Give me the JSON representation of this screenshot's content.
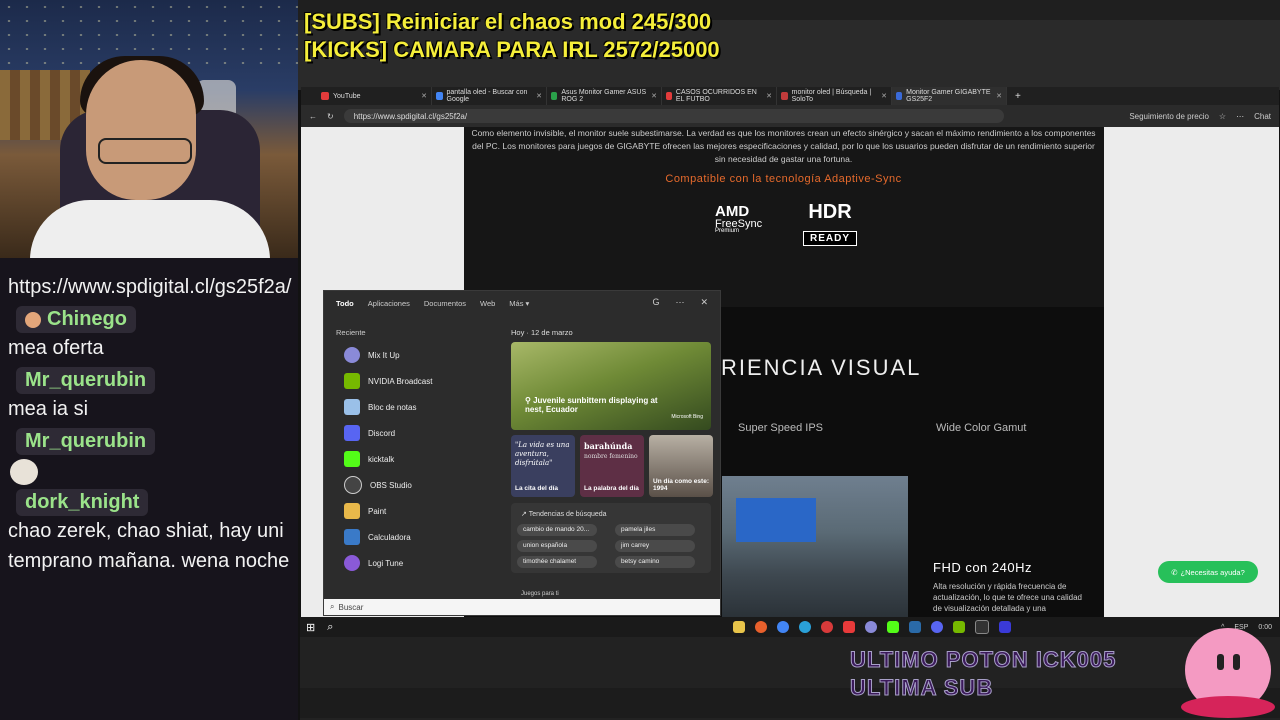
{
  "overlay": {
    "line1": "[SUBS] Reiniciar el chaos mod 245/300",
    "line2": "[KICKS] CAMARA PARA IRL 2572/25000",
    "bottom1": "ULTIMO POTON",
    "bottom2": "ULTIMA SUB",
    "bottom_tag": "ICK005"
  },
  "chat": {
    "messages": [
      {
        "text": "https://www.spdigital.cl/gs25f2a/"
      },
      {
        "name": "Chinego",
        "text": "mea oferta"
      },
      {
        "name": "Mr_querubin",
        "text": "mea ia si"
      },
      {
        "name": "Mr_querubin",
        "text": ""
      },
      {
        "name": "dork_knight",
        "text": "chao zerek, chao shiat, hay uni temprano mañana. wena noche"
      }
    ]
  },
  "browser": {
    "tabs": [
      {
        "label": "YouTube"
      },
      {
        "label": "pantalla oled - Buscar con Google"
      },
      {
        "label": "Asus Monitor Gamer ASUS ROG 2"
      },
      {
        "label": "CASOS OCURRIDOS EN EL FUTBO"
      },
      {
        "label": "monitor oled | Búsqueda | SoloTo"
      },
      {
        "label": "Monitor Gamer GIGABYTE GS25F2"
      }
    ],
    "url": "https://www.spdigital.cl/gs25f2a/",
    "price_tracking": "Seguimiento de precio",
    "chat_label": "Chat"
  },
  "page": {
    "paragraph": "Como elemento invisible, el monitor suele subestimarse. La verdad es que los monitores crean un efecto sinérgico y sacan el máximo rendimiento a los componentes del PC. Los monitores para juegos de GIGABYTE ofrecen las mejores especificaciones y calidad, por lo que los usuarios pueden disfrutar de un rendimiento superior sin necesidad de gastar una fortuna.",
    "compat": "Compatible con la tecnología Adaptive-Sync",
    "amd": "AMD",
    "freesync": "FreeSync",
    "premium": "Premium",
    "hdr": "HDR",
    "ready": "READY",
    "visual": "RIENCIA VISUAL",
    "tab1": "Super Speed IPS",
    "tab2": "Wide Color Gamut",
    "fhd_title": "FHD con 240Hz",
    "fhd_desc": "Alta resolución y rápida frecuencia de actualización, lo que te ofrece una calidad de visualización detallada y una",
    "whatsapp": "¿Necesitas ayuda?"
  },
  "start": {
    "tabs": [
      "Todo",
      "Aplicaciones",
      "Documentos",
      "Web",
      "Más ▾"
    ],
    "recent_title": "Reciente",
    "apps": [
      {
        "label": "Mix It Up",
        "color": "#8a8ad8"
      },
      {
        "label": "NVIDIA Broadcast",
        "color": "#76b900"
      },
      {
        "label": "Bloc de notas",
        "color": "#9ac0e8"
      },
      {
        "label": "Discord",
        "color": "#5865f2"
      },
      {
        "label": "kicktalk",
        "color": "#53fc18"
      },
      {
        "label": "OBS Studio",
        "color": "#444444"
      },
      {
        "label": "Paint",
        "color": "#e8b84a"
      },
      {
        "label": "Calculadora",
        "color": "#3a7ac8"
      },
      {
        "label": "Logi Tune",
        "color": "#8a5ad8"
      }
    ],
    "today": "Hoy  ·  12 de marzo",
    "featured_caption": "Juvenile sunbittern displaying at nest, Ecuador",
    "ms_bing": "Microsoft Bing",
    "card1_quote": "\"La vida es una aventura, disfrútala\"",
    "card1_label": "La cita del día",
    "card2_word": "barahúnda",
    "card2_sub": "nombre femenino",
    "card2_label": "La palabra del día",
    "card3_label": "Un día como este: 1994",
    "trends_title": "Tendencias de búsqueda",
    "trends": [
      "cambio de mando 20...",
      "pamela jiles",
      "union española",
      "jim carrey",
      "timothée chalamet",
      "betsy camino"
    ],
    "trend_more": "Juegos para ti",
    "search_placeholder": "Buscar"
  },
  "taskbar": {
    "lang": "ESP",
    "time": "0:00"
  }
}
